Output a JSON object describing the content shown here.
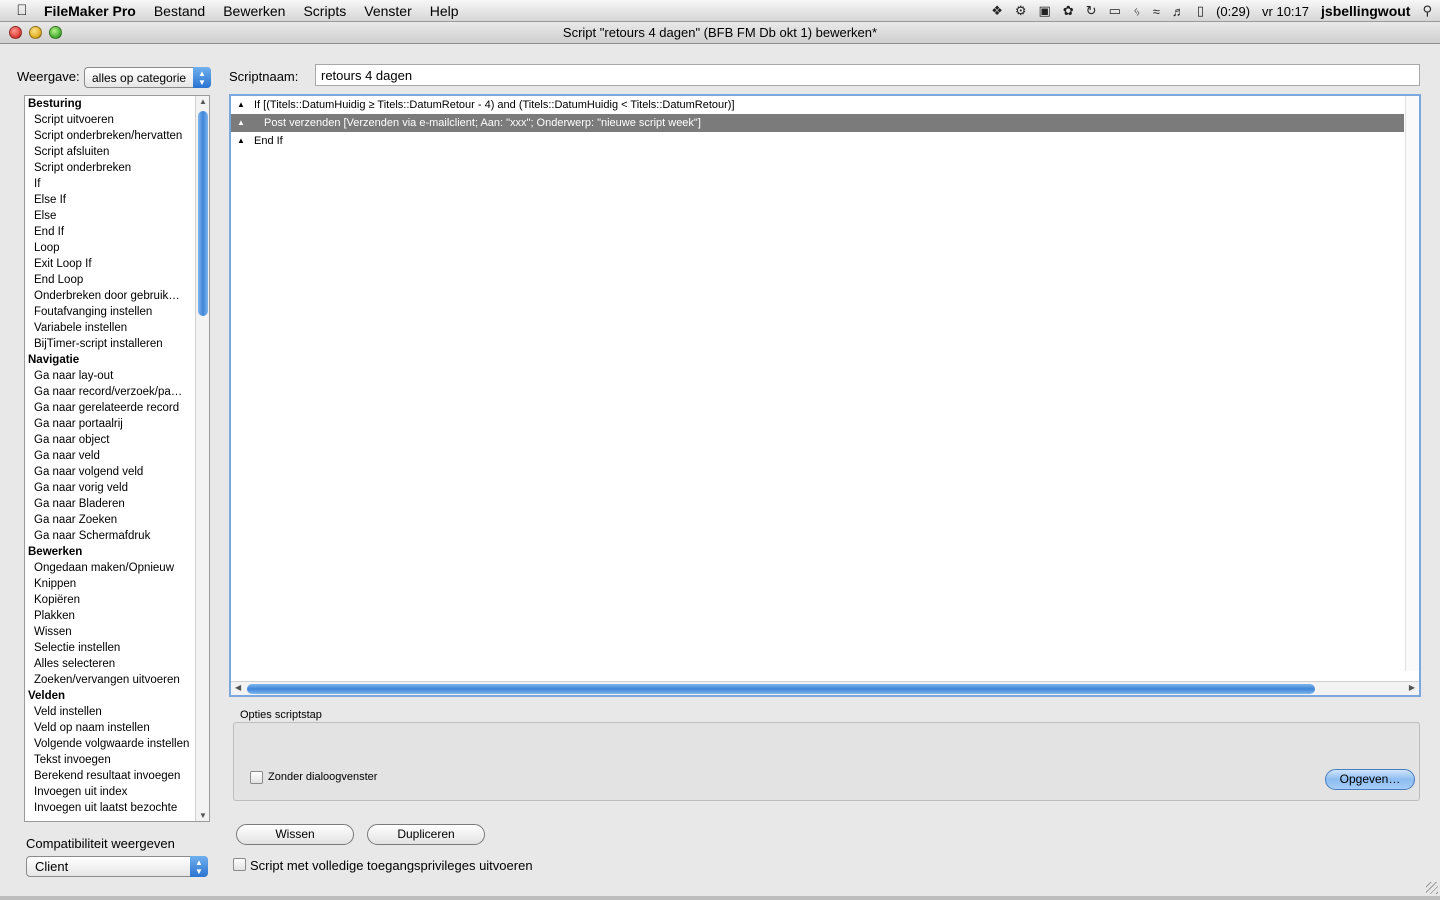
{
  "menubar": {
    "app_name": "FileMaker Pro",
    "items": [
      "Bestand",
      "Bewerken",
      "Scripts",
      "Venster",
      "Help"
    ],
    "battery": "(0:29)",
    "clock": "vr 10:17",
    "user": "jsbellingwout"
  },
  "window": {
    "title": "Script \"retours 4 dagen\" (BFB FM Db okt 1) bewerken*"
  },
  "view": {
    "label": "Weergave:",
    "selected": "alles op categorie"
  },
  "steps": [
    {
      "category": "Besturing",
      "items": [
        "Script uitvoeren",
        "Script onderbreken/hervatten",
        "Script afsluiten",
        "Script onderbreken",
        "If",
        "Else If",
        "Else",
        "End If",
        "Loop",
        "Exit Loop If",
        "End Loop",
        "Onderbreken door gebruik…",
        "Foutafvanging instellen",
        "Variabele instellen",
        "BijTimer-script installeren"
      ]
    },
    {
      "category": "Navigatie",
      "items": [
        "Ga naar lay-out",
        "Ga naar record/verzoek/pa…",
        "Ga naar gerelateerde record",
        "Ga naar portaalrij",
        "Ga naar object",
        "Ga naar veld",
        "Ga naar volgend veld",
        "Ga naar vorig veld",
        "Ga naar Bladeren",
        "Ga naar Zoeken",
        "Ga naar Schermafdruk"
      ]
    },
    {
      "category": "Bewerken",
      "items": [
        "Ongedaan maken/Opnieuw",
        "Knippen",
        "Kopiëren",
        "Plakken",
        "Wissen",
        "Selectie instellen",
        "Alles selecteren",
        "Zoeken/vervangen uitvoeren"
      ]
    },
    {
      "category": "Velden",
      "items": [
        "Veld instellen",
        "Veld op naam instellen",
        "Volgende volgwaarde instellen",
        "Tekst invoegen",
        "Berekend resultaat invoegen",
        "Invoegen uit index",
        "Invoegen uit laatst bezochte"
      ]
    }
  ],
  "compat": {
    "label": "Compatibiliteit weergeven",
    "selected": "Client"
  },
  "script": {
    "name_label": "Scriptnaam:",
    "name_value": "retours 4 dagen",
    "lines": [
      "If [(Titels::DatumHuidig ≥ Titels::DatumRetour - 4) and (Titels::DatumHuidig < Titels::DatumRetour)]",
      "Post verzenden [Verzenden via e-mailclient; Aan: \"xxx\"; Onderwerp: \"nieuwe script week\"]",
      "End If"
    ]
  },
  "options": {
    "label": "Opties scriptstap",
    "no_dialog_label": "Zonder dialoogvenster",
    "fetch_button": "Opgeven…"
  },
  "buttons": {
    "clear": "Wissen",
    "duplicate": "Dupliceren"
  },
  "privileges_label": "Script met volledige toegangsprivileges uitvoeren"
}
